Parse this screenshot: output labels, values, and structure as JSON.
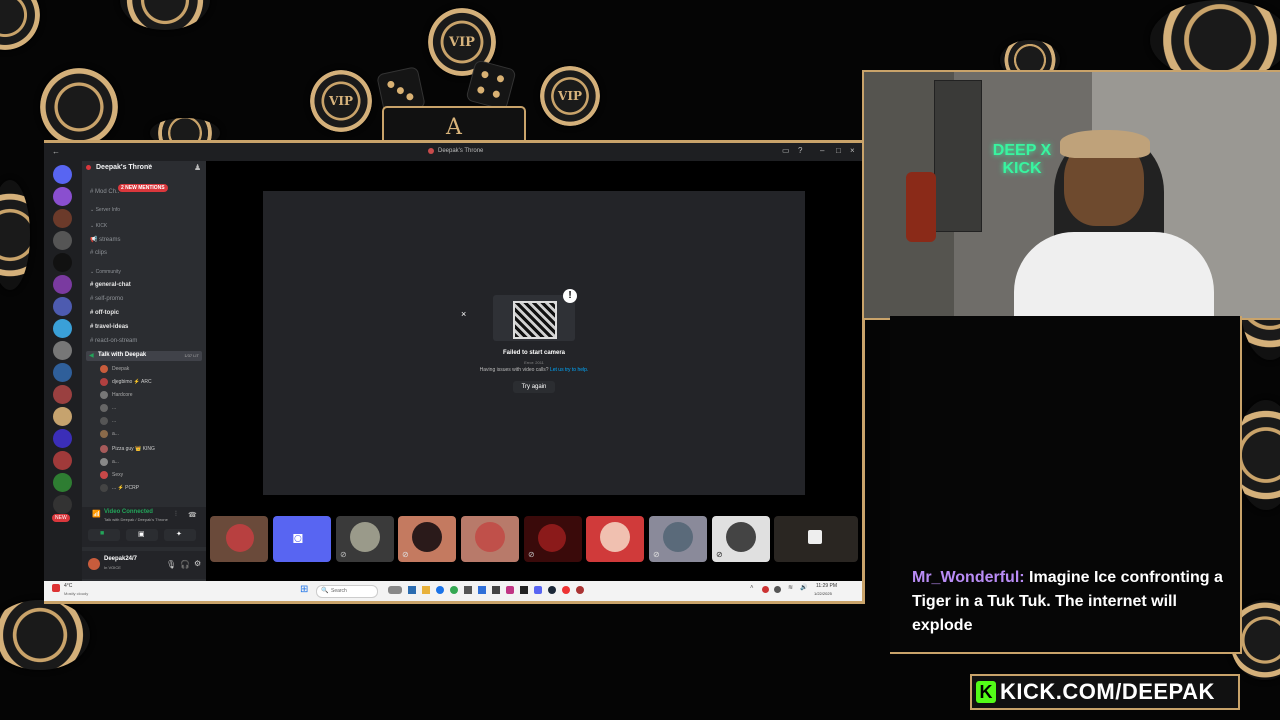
{
  "discord": {
    "window_title": "Deepak's Throne",
    "server_name": "Deepak's Throne",
    "mention_badge": "2 NEW MENTIONS",
    "channels": [
      {
        "label": "Mod Ch..",
        "kind": "text"
      },
      {
        "label": "Server Info",
        "kind": "category"
      },
      {
        "label": "KICK",
        "kind": "category"
      },
      {
        "label": "streams",
        "kind": "text"
      },
      {
        "label": "clips",
        "kind": "text"
      },
      {
        "label": "Community",
        "kind": "category"
      },
      {
        "label": "general-chat",
        "kind": "text"
      },
      {
        "label": "self-promo",
        "kind": "text"
      },
      {
        "label": "off-topic",
        "kind": "text"
      },
      {
        "label": "travel-ideas",
        "kind": "text"
      },
      {
        "label": "react-on-stream",
        "kind": "text"
      },
      {
        "label": "Talk with Deepak",
        "kind": "voice"
      }
    ],
    "voice_count": "1/37 LIT",
    "voice_users": [
      "Deepak",
      "djegbimo ⚡ ARC",
      "Hardcore",
      "...",
      "...",
      "a...",
      "Pizza guy 👑 KING",
      "a...",
      "Sexy",
      "... ⚡ PCRP"
    ],
    "voice_status": "Video Connected",
    "voice_sub": "Talk with Deepak / Deepak's Throne",
    "user_name": "Deepak24/7",
    "user_status": "In VOICE",
    "server_badges": [
      "NEW"
    ],
    "camera_error_title": "Failed to start camera",
    "camera_error_code": "Error: 2011",
    "camera_help_prefix": "Having issues with video calls?",
    "camera_help_link": "Let us try to help.",
    "try_again_label": "Try again",
    "search_placeholder": "Search",
    "weather": "4°C",
    "weather_sub": "Mostly cloudy",
    "clock_time": "11:29 PM",
    "clock_date": "1/22/2025"
  },
  "overlay": {
    "chat_user": "Mr_Wonderful:",
    "chat_message": "Imagine Ice confronting a Tiger in a Tuk Tuk. The internet will explode",
    "kick_brand": "KICK.COM/DEEPAK",
    "vip_chip_text": "VIP",
    "card_text": "A",
    "neon_sign": "DEEP X KICK"
  },
  "colors": {
    "gold": "#c9a36a",
    "chat_user": "#b98cf5",
    "kick_green": "#53fc18",
    "discord_bg": "#1e1f22",
    "discord_sidebar": "#2b2d31",
    "voice_green": "#23a55a",
    "link_blue": "#00a8fc"
  }
}
